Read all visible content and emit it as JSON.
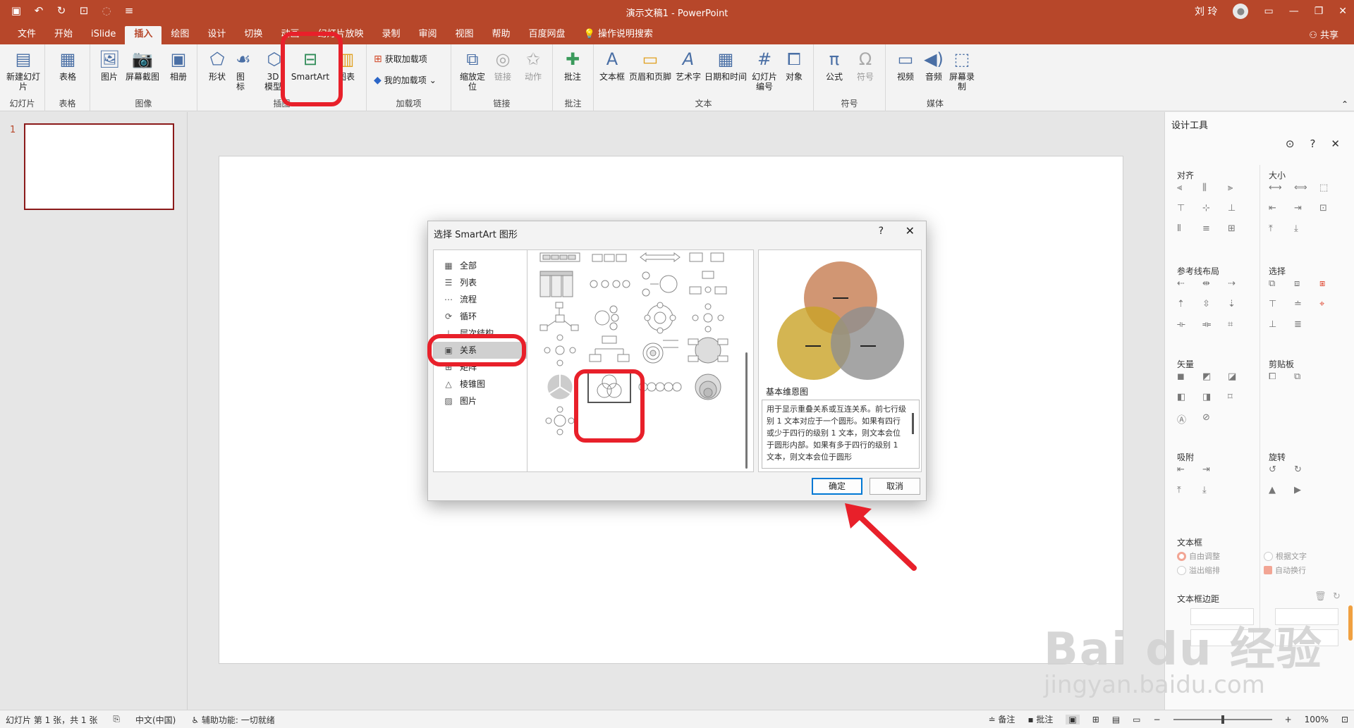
{
  "titlebar": {
    "doc_title": "演示文稿1 - PowerPoint",
    "user_name": "刘 玲"
  },
  "tabs": [
    "文件",
    "开始",
    "iSlide",
    "插入",
    "绘图",
    "设计",
    "切换",
    "动画",
    "幻灯片放映",
    "录制",
    "审阅",
    "视图",
    "帮助",
    "百度网盘",
    "操作说明搜索"
  ],
  "active_tab": "插入",
  "share_label": "共享",
  "ribbon": {
    "groups": {
      "slides": "幻灯片",
      "tables": "表格",
      "images": "图像",
      "illustrations": "插图",
      "addins": "加载项",
      "links": "链接",
      "comments": "批注",
      "text": "文本",
      "symbols": "符号",
      "media": "媒体"
    },
    "buttons": {
      "new_slide": "新建幻灯片",
      "table": "表格",
      "picture": "图片",
      "screenshot": "屏幕截图",
      "album": "相册",
      "shapes": "形状",
      "icons": "图标",
      "model3d": "3D 模型",
      "smartart": "SmartArt",
      "chart": "图表",
      "get_addins": "获取加载项",
      "my_addins": "我的加载项",
      "zoom": "缩放定位",
      "link": "链接",
      "action": "动作",
      "comment": "批注",
      "textbox": "文本框",
      "header_footer": "页眉和页脚",
      "wordart": "艺术字",
      "datetime": "日期和时间",
      "slide_number": "幻灯片编号",
      "object": "对象",
      "equation": "公式",
      "symbol": "符号",
      "video": "视频",
      "audio": "音频",
      "screen_record": "屏幕录制"
    }
  },
  "thumbs": {
    "slide_number": "1"
  },
  "design_pane": {
    "title": "设计工具",
    "sections": {
      "align": "对齐",
      "size": "大小",
      "guides": "参考线布局",
      "select": "选择",
      "vector": "矢量",
      "clipboard": "剪贴板",
      "snap": "吸附",
      "rotate": "旋转",
      "textbox": "文本框",
      "textbox_margin": "文本框边距"
    },
    "options": {
      "auto_adjust": "自由调整",
      "fit_text": "根据文字",
      "overflow_shrink": "溢出缩排",
      "auto_wrap": "自动换行"
    }
  },
  "statusbar": {
    "slide_info": "幻灯片 第 1 张，共 1 张",
    "language": "中文(中国)",
    "accessibility": "辅助功能: 一切就绪",
    "notes": "备注",
    "comments": "批注",
    "zoom": "100%"
  },
  "dialog": {
    "title": "选择 SmartArt 图形",
    "help": "?",
    "categories": [
      "全部",
      "列表",
      "流程",
      "循环",
      "层次结构",
      "关系",
      "矩阵",
      "棱锥图",
      "图片"
    ],
    "selected_category": "关系",
    "preview_name": "基本维恩图",
    "preview_description": "用于显示重叠关系或互连关系。前七行级别 1 文本对应于一个圆形。如果有四行或少于四行的级别 1 文本，则文本会位于圆形内部。如果有多于四行的级别 1 文本，则文本会位于圆形",
    "ok": "确定",
    "cancel": "取消"
  },
  "watermark": {
    "logo": "Bai du 经验",
    "sub": "jingyan.baidu.com"
  },
  "colors": {
    "accent": "#b7472a",
    "highlight": "#e8202a",
    "venn1": "#c9845a",
    "venn2": "#c9a227",
    "venn3": "#8e8e8e"
  }
}
